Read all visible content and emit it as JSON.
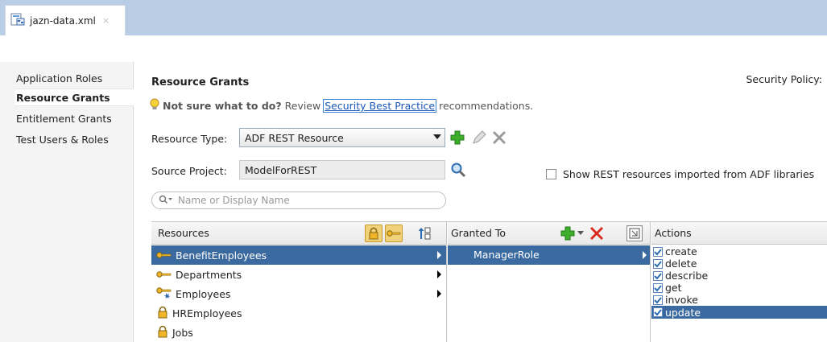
{
  "tab": {
    "title": "jazn-data.xml",
    "close": "×"
  },
  "nav": {
    "items": [
      {
        "label": "Application Roles",
        "active": false
      },
      {
        "label": "Resource Grants",
        "active": true
      },
      {
        "label": "Entitlement Grants",
        "active": false
      },
      {
        "label": "Test Users & Roles",
        "active": false
      }
    ]
  },
  "header": {
    "title": "Resource Grants",
    "policy_label": "Security Policy:"
  },
  "hint": {
    "bold": "Not sure what to do?",
    "text": "Review",
    "link": "Security Best Practice",
    "tail": "recommendations."
  },
  "resource_type": {
    "label": "Resource Type:",
    "value": "ADF REST Resource"
  },
  "source_project": {
    "label": "Source Project:",
    "value": "ModelForREST"
  },
  "show_rest_checkbox": {
    "label": "Show REST resources imported from ADF libraries",
    "checked": false
  },
  "filter": {
    "placeholder": "Name or Display Name"
  },
  "grid": {
    "resources_header": "Resources",
    "granted_header": "Granted To",
    "actions_header": "Actions",
    "resources": [
      {
        "name": "BenefitEmployees",
        "icon": "key-icon",
        "selected": true,
        "has_arrow": true
      },
      {
        "name": "Departments",
        "icon": "key-icon",
        "selected": false,
        "has_arrow": true
      },
      {
        "name": "Employees",
        "icon": "key-star-icon",
        "selected": false,
        "has_arrow": true
      },
      {
        "name": "HREmployees",
        "icon": "lock-icon",
        "selected": false,
        "has_arrow": false
      },
      {
        "name": "Jobs",
        "icon": "lock-icon",
        "selected": false,
        "has_arrow": false
      }
    ],
    "granted": [
      {
        "name": "ManagerRole",
        "selected": true
      }
    ],
    "actions": [
      {
        "name": "create",
        "checked": true,
        "selected": false
      },
      {
        "name": "delete",
        "checked": true,
        "selected": false
      },
      {
        "name": "describe",
        "checked": true,
        "selected": false
      },
      {
        "name": "get",
        "checked": true,
        "selected": false
      },
      {
        "name": "invoke",
        "checked": true,
        "selected": false
      },
      {
        "name": "update",
        "checked": true,
        "selected": true
      }
    ]
  },
  "colors": {
    "selection": "#3b6aa0",
    "tabstrip": "#b9cde5",
    "add_green": "#3fae2a",
    "delete_red": "#d9281c",
    "link": "#1a56b8"
  }
}
